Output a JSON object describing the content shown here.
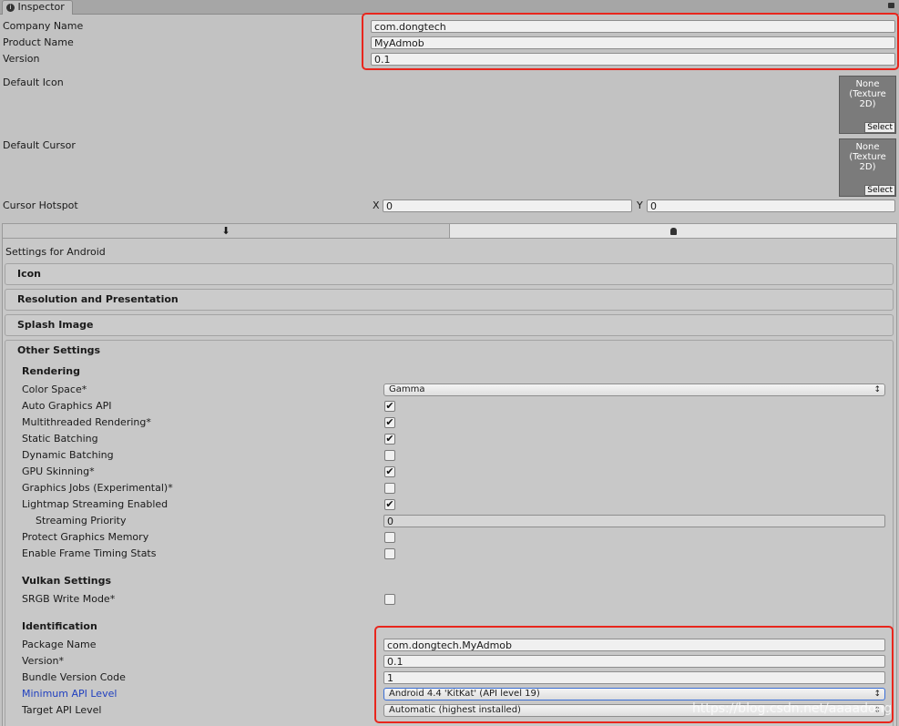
{
  "tab": {
    "title": "Inspector"
  },
  "player": {
    "company_name_label": "Company Name",
    "company_name": "com.dongtech",
    "product_name_label": "Product Name",
    "product_name": "MyAdmob",
    "version_label": "Version",
    "version": "0.1",
    "default_icon_label": "Default Icon",
    "default_cursor_label": "Default Cursor",
    "texture_none": "None\n(Texture\n2D)",
    "select_label": "Select",
    "cursor_hotspot_label": "Cursor Hotspot",
    "hotspot_x_label": "X",
    "hotspot_x": "0",
    "hotspot_y_label": "Y",
    "hotspot_y": "0"
  },
  "platform_tabs": [
    {
      "icon": "download-icon",
      "active": false
    },
    {
      "icon": "android-icon",
      "active": true
    }
  ],
  "settings_for": "Settings for Android",
  "sections": {
    "icon": "Icon",
    "resolution": "Resolution and Presentation",
    "splash": "Splash Image",
    "other": "Other Settings"
  },
  "rendering": {
    "heading": "Rendering",
    "color_space_label": "Color Space*",
    "color_space": "Gamma",
    "rows": [
      {
        "label": "Auto Graphics API",
        "checked": true
      },
      {
        "label": "Multithreaded Rendering*",
        "checked": true
      },
      {
        "label": "Static Batching",
        "checked": true
      },
      {
        "label": "Dynamic Batching",
        "checked": false
      },
      {
        "label": "GPU Skinning*",
        "checked": true
      },
      {
        "label": "Graphics Jobs (Experimental)*",
        "checked": false
      },
      {
        "label": "Lightmap Streaming Enabled",
        "checked": true
      }
    ],
    "streaming_priority_label": "Streaming Priority",
    "streaming_priority": "0",
    "protect_memory_label": "Protect Graphics Memory",
    "protect_memory": false,
    "frame_timing_label": "Enable Frame Timing Stats",
    "frame_timing": false
  },
  "vulkan": {
    "heading": "Vulkan Settings",
    "srgb_label": "SRGB Write Mode*",
    "srgb": false
  },
  "identification": {
    "heading": "Identification",
    "package_name_label": "Package Name",
    "package_name": "com.dongtech.MyAdmob",
    "version_label": "Version*",
    "version": "0.1",
    "bundle_code_label": "Bundle Version Code",
    "bundle_code": "1",
    "min_api_label": "Minimum API Level",
    "min_api": "Android 4.4 'KitKat' (API level 19)",
    "target_api_label": "Target API Level",
    "target_api": "Automatic (highest installed)"
  },
  "watermark": "https://blog.csdn.net/aaaadong",
  "colors": {
    "highlight": "#e8261d",
    "link_label": "#1f3fbf"
  }
}
